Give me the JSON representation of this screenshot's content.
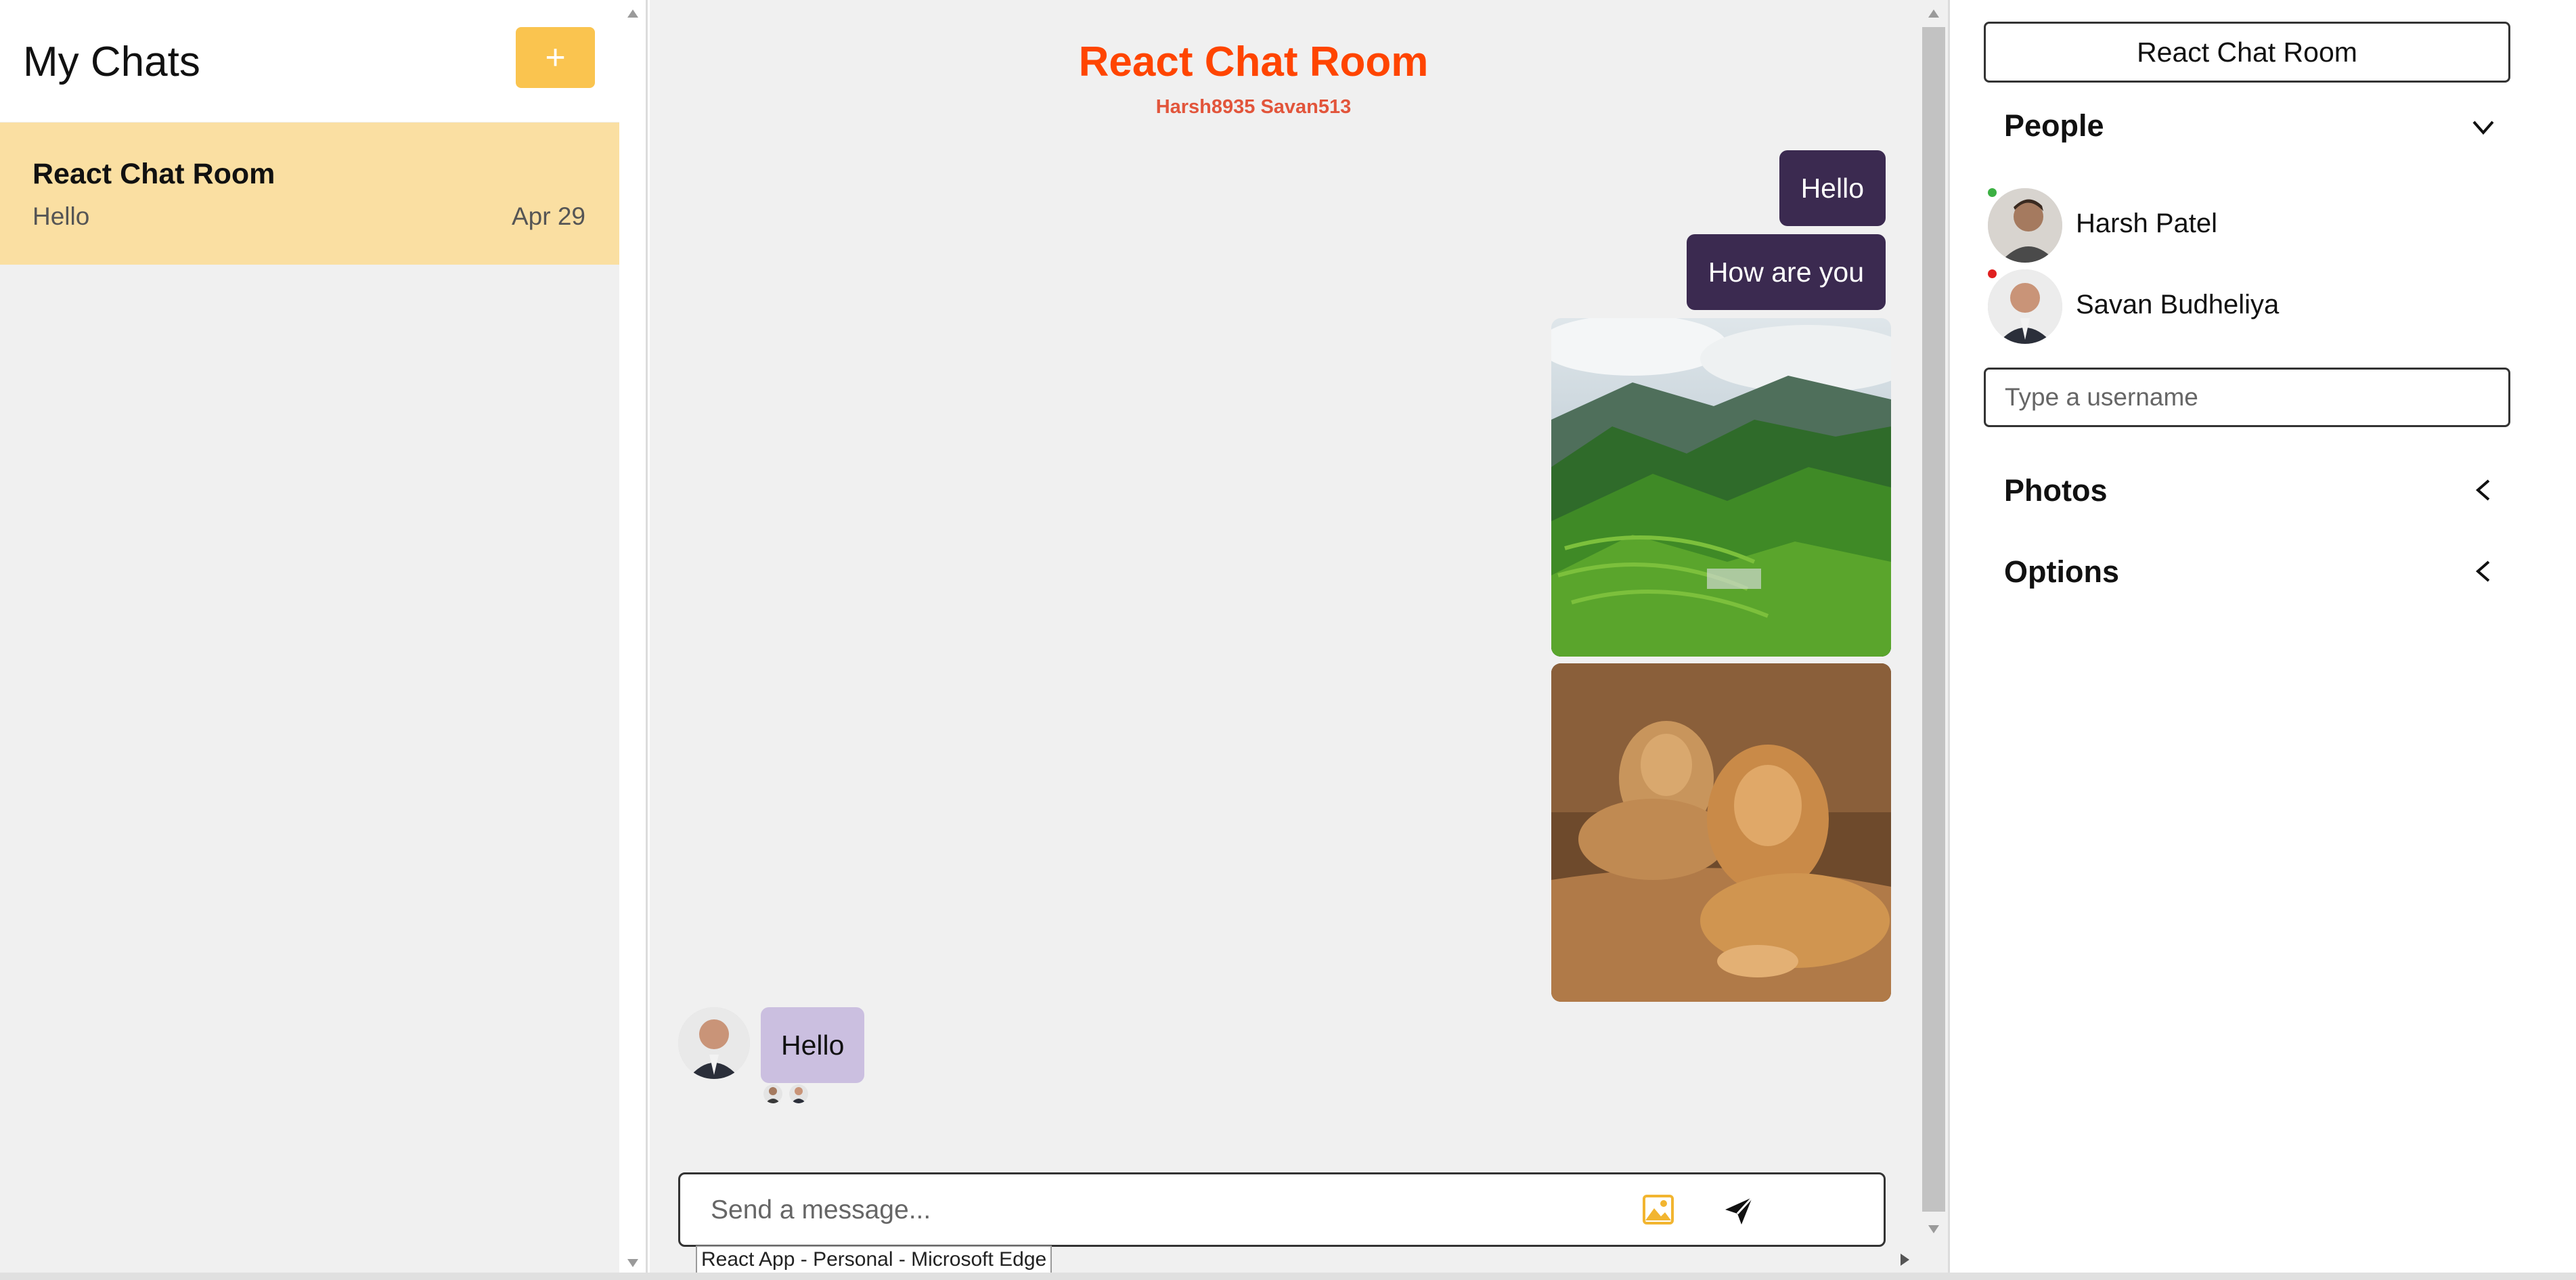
{
  "sidebar": {
    "title": "My Chats",
    "add_label": "+",
    "chats": [
      {
        "title": "React Chat Room",
        "last_message": "Hello",
        "date": "Apr 29"
      }
    ]
  },
  "room": {
    "title": "React Chat Room",
    "subtitle": "Harsh8935 Savan513",
    "messages_me": [
      "Hello",
      "How are you"
    ],
    "message_other": "Hello",
    "composer_placeholder": "Send a message..."
  },
  "tooltip": "React App - Personal - Microsoft Edge",
  "settings": {
    "title": "React Chat Room",
    "people_label": "People",
    "people": [
      {
        "name": "Harsh Patel",
        "status_color": "#3cb043"
      },
      {
        "name": "Savan Budheliya",
        "status_color": "#e02020"
      }
    ],
    "username_placeholder": "Type a username",
    "photos_label": "Photos",
    "options_label": "Options"
  },
  "colors": {
    "accent_title": "#ff4500",
    "add_button": "#fac44f",
    "active_chat": "#fadfa2",
    "my_bubble": "#3b2a50",
    "other_bubble": "#cbbfe0"
  },
  "icons": [
    "plus-icon",
    "image-upload-icon",
    "send-icon",
    "chevron-down-icon",
    "chevron-left-icon"
  ]
}
